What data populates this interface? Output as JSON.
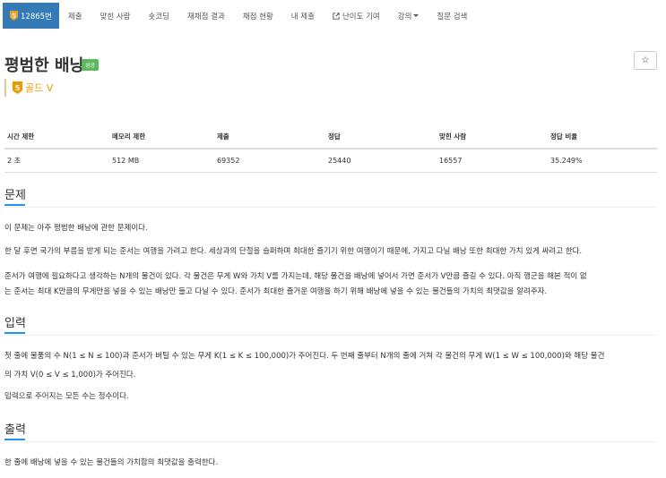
{
  "nav": {
    "problem_id": "12865번",
    "tier_badge_char": "5",
    "items": [
      "제출",
      "맞힌 사람",
      "숏코딩",
      "재채점 결과",
      "채점 현황",
      "내 제출",
      "난이도 기여",
      "강의",
      "질문 검색"
    ]
  },
  "problem": {
    "title": "평범한 배낭",
    "status": "성공",
    "star": "☆",
    "tier_char": "5",
    "tier": "골드 V"
  },
  "stats": {
    "headers": [
      "시간 제한",
      "메모리 제한",
      "제출",
      "정답",
      "맞힌 사람",
      "정답 비율"
    ],
    "values": [
      "2 초",
      "512 MB",
      "69352",
      "25440",
      "16557",
      "35.249%"
    ]
  },
  "sections": {
    "description": {
      "heading": "문제",
      "p1": "이 문제는 아주 평범한 배낭에 관한 문제이다.",
      "p2": "한 달 후면 국가의 부름을 받게 되는 준서는 여행을 가려고 한다. 세상과의 단절을 슬퍼하며 최대한 즐기기 위한 여행이기 때문에, 가지고 다닐 배낭 또한 최대한 가치 있게 싸려고 한다.",
      "p3_l1": "준서가 여행에 필요하다고 생각하는 N개의 물건이 있다. 각 물건은 무게 W와 가치 V를 가지는데, 해당 물건을 배낭에 넣어서 가면 준서가 V만큼 즐길 수 있다. 아직 행군을 해본 적이 없",
      "p3_l2": "는 준서는 최대 K만큼의 무게만을 넣을 수 있는 배낭만 들고 다닐 수 있다. 준서가 최대한 즐거운 여행을 하기 위해 배낭에 넣을 수 있는 물건들의 가치의 최댓값을 알려주자."
    },
    "input": {
      "heading": "입력",
      "p1_l1": "첫 줄에 물품의 수 N(1 ≤ N ≤ 100)과 준서가 버틸 수 있는 무게 K(1 ≤ K ≤ 100,000)가 주어진다. 두 번째 줄부터 N개의 줄에 거쳐 각 물건의 무게 W(1 ≤ W ≤ 100,000)와 해당 물건",
      "p1_l2": "의 가치 V(0 ≤ V ≤ 1,000)가 주어진다.",
      "p2": "입력으로 주어지는 모든 수는 정수이다."
    },
    "output": {
      "heading": "출력",
      "p1": "한 줄에 배낭에 넣을 수 있는 물건들의 가치합의 최댓값을 출력한다."
    }
  },
  "colors": {
    "accent": "#337ab7",
    "tier_gold": "#ec9a00",
    "success": "#5cb85c",
    "section_underline": "#1e90ff"
  }
}
